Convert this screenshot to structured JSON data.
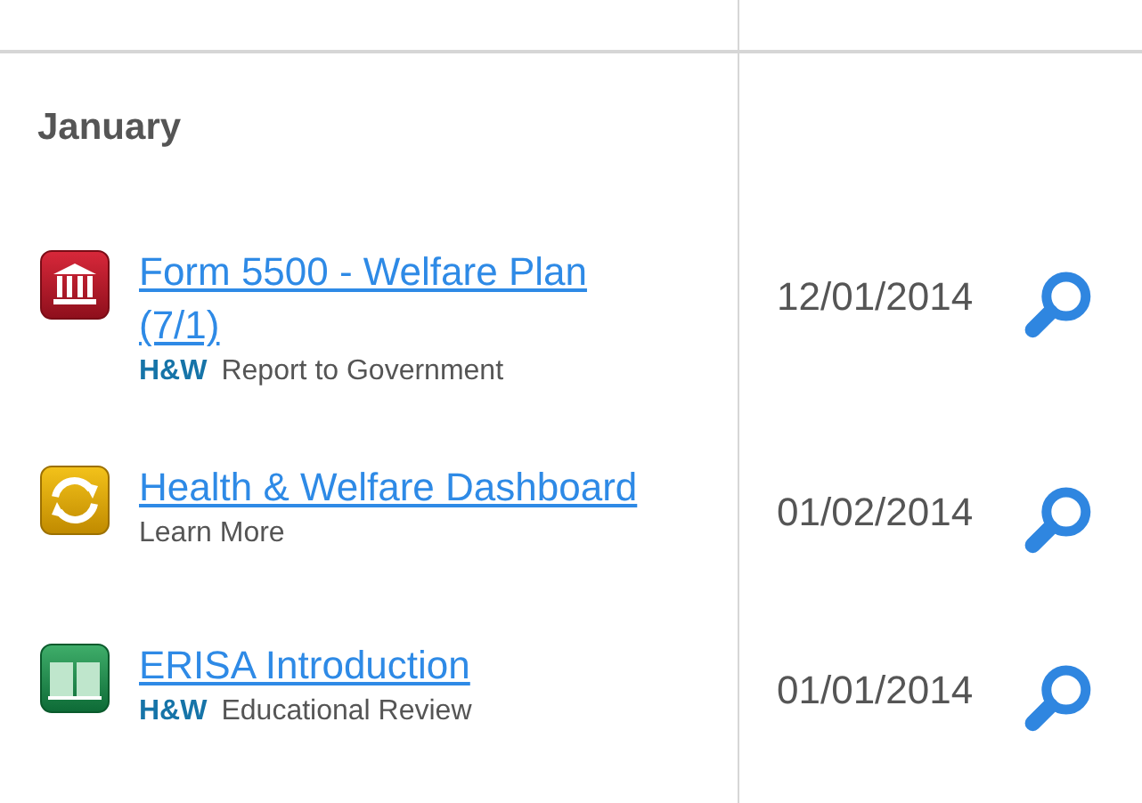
{
  "section": {
    "heading": "January"
  },
  "items": [
    {
      "kind": "government",
      "title": "Form 5500 - Welfare Plan (7/1)",
      "tag": "H&W",
      "subtitle": "Report to Government",
      "date": "12/01/2014"
    },
    {
      "kind": "dashboard",
      "title": "Health & Welfare Dashboard",
      "subtitle": "Learn More",
      "date": "01/02/2014"
    },
    {
      "kind": "education",
      "title": "ERISA Introduction",
      "tag": "H&W",
      "subtitle": "Educational Review",
      "date": "01/01/2014"
    }
  ]
}
